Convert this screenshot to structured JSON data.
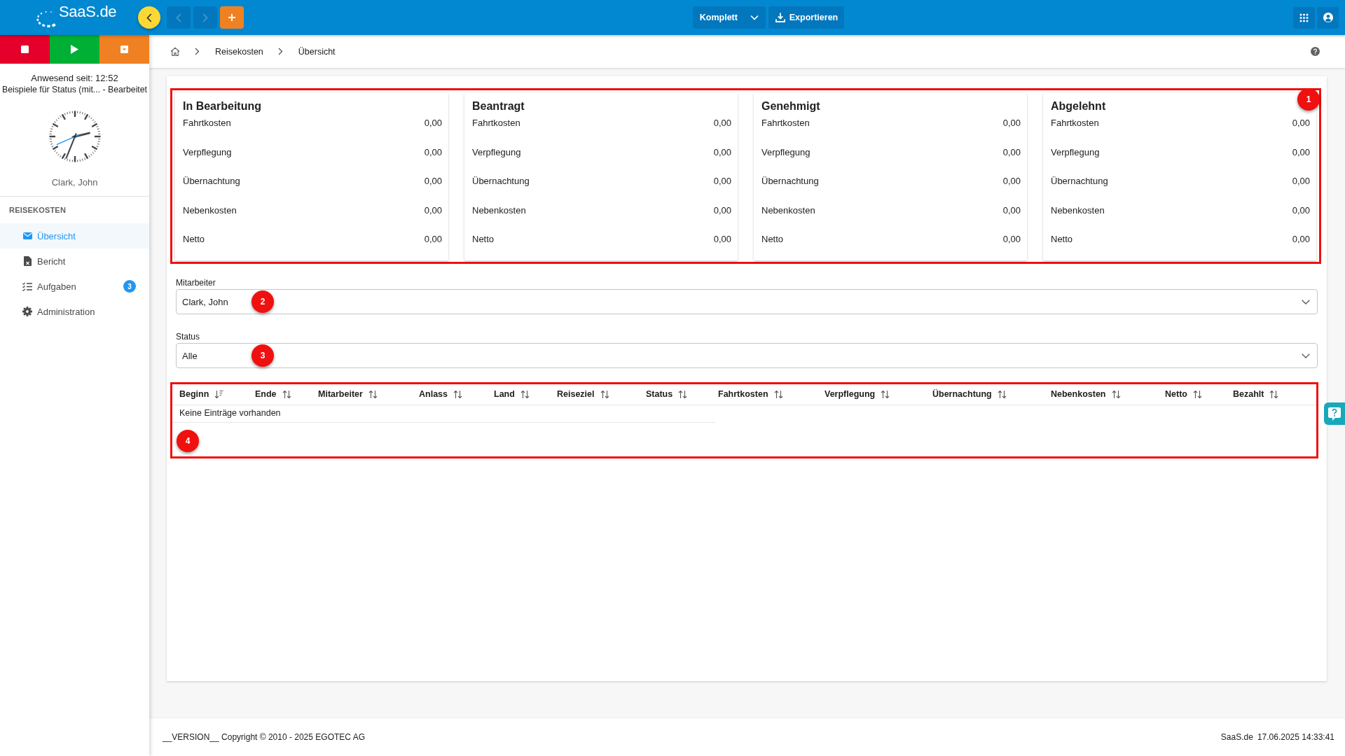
{
  "top_bar": {
    "logo": "SaaS.de",
    "history_buttons": [
      {
        "kind": "back",
        "disabled": true
      },
      {
        "kind": "forward",
        "disabled": true
      }
    ],
    "view_select": "Komplett",
    "export_button": "Exportieren"
  },
  "sidebar": {
    "time_buttons": [
      {
        "kind": "stop",
        "color": "#e4002b"
      },
      {
        "kind": "start",
        "color": "#00b034"
      },
      {
        "kind": "menu",
        "color": "#f08122"
      }
    ],
    "presence": "Anwesend seit: 12:52",
    "status": "Beispiele für Status (mit... - Bearbeitet",
    "user_name": "Clark, John",
    "section_title": "REISEKOSTEN",
    "items": [
      {
        "label": "Übersicht",
        "selected": true
      },
      {
        "label": "Bericht",
        "selected": false
      },
      {
        "label": "Aufgaben",
        "selected": false,
        "badge": "3"
      },
      {
        "label": "Administration",
        "selected": false
      }
    ]
  },
  "breadcrumb": [
    "Reisekosten",
    "Übersicht"
  ],
  "summary": {
    "annotation": {
      "number": "1",
      "framed": true
    },
    "cards": [
      {
        "title": "In Bearbeitung",
        "rows": [
          {
            "label": "Fahrtkosten",
            "value": "0,00"
          },
          {
            "label": "Verpflegung",
            "value": "0,00"
          },
          {
            "label": "Übernachtung",
            "value": "0,00"
          },
          {
            "label": "Nebenkosten",
            "value": "0,00"
          },
          {
            "label": "Netto",
            "value": "0,00"
          }
        ]
      },
      {
        "title": "Beantragt",
        "rows": [
          {
            "label": "Fahrtkosten",
            "value": "0,00"
          },
          {
            "label": "Verpflegung",
            "value": "0,00"
          },
          {
            "label": "Übernachtung",
            "value": "0,00"
          },
          {
            "label": "Nebenkosten",
            "value": "0,00"
          },
          {
            "label": "Netto",
            "value": "0,00"
          }
        ]
      },
      {
        "title": "Genehmigt",
        "rows": [
          {
            "label": "Fahrtkosten",
            "value": "0,00"
          },
          {
            "label": "Verpflegung",
            "value": "0,00"
          },
          {
            "label": "Übernachtung",
            "value": "0,00"
          },
          {
            "label": "Nebenkosten",
            "value": "0,00"
          },
          {
            "label": "Netto",
            "value": "0,00"
          }
        ]
      },
      {
        "title": "Abgelehnt",
        "rows": [
          {
            "label": "Fahrtkosten",
            "value": "0,00"
          },
          {
            "label": "Verpflegung",
            "value": "0,00"
          },
          {
            "label": "Übernachtung",
            "value": "0,00"
          },
          {
            "label": "Nebenkosten",
            "value": "0,00"
          },
          {
            "label": "Netto",
            "value": "0,00"
          }
        ]
      }
    ]
  },
  "filters": [
    {
      "label": "Mitarbeiter",
      "value": "Clark, John",
      "annotation": {
        "number": "2"
      }
    },
    {
      "label": "Status",
      "value": "Alle",
      "annotation": {
        "number": "3"
      }
    }
  ],
  "table": {
    "annotation": {
      "number": "4",
      "framed": true
    },
    "columns": [
      {
        "label": "Beginn",
        "sorted": true
      },
      {
        "label": "Ende",
        "sorted": false
      },
      {
        "label": "Mitarbeiter",
        "sorted": false
      },
      {
        "label": "Anlass",
        "sorted": false
      },
      {
        "label": "Land",
        "sorted": false
      },
      {
        "label": "Reiseziel",
        "sorted": false
      },
      {
        "label": "Status",
        "sorted": false
      },
      {
        "label": "Fahrtkosten",
        "sorted": false
      },
      {
        "label": "Verpflegung",
        "sorted": false
      },
      {
        "label": "Übernachtung",
        "sorted": false
      },
      {
        "label": "Nebenkosten",
        "sorted": false
      },
      {
        "label": "Netto",
        "sorted": false
      },
      {
        "label": "Bezahlt",
        "sorted": false
      }
    ],
    "empty_message": "Keine Einträge vorhanden"
  },
  "footer": {
    "copyright": "__VERSION__ Copyright © 2010 - 2025 EGOTEC AG",
    "site": "SaaS.de",
    "timestamp": "17.06.2025 14:33:41"
  }
}
